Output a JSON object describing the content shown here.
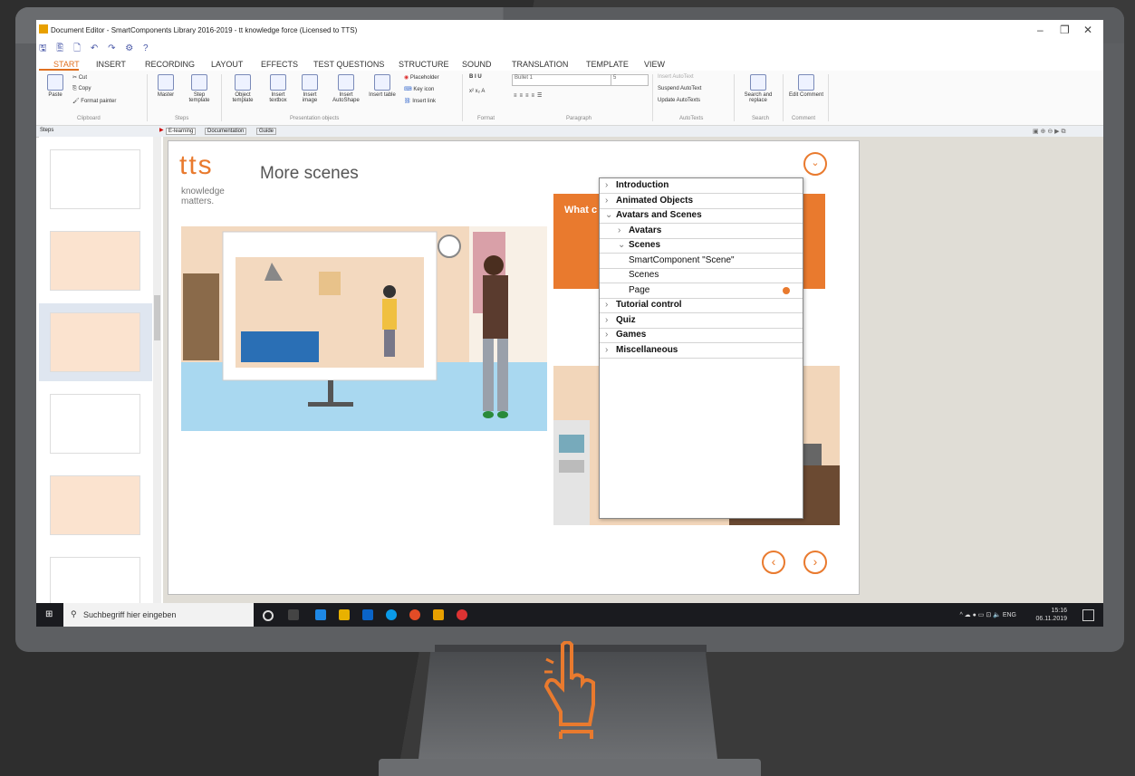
{
  "window": {
    "title": "Document Editor - SmartComponents Library 2016-2019 - tt knowledge force (Licensed to TTS)",
    "minimize": "–",
    "restore": "❐",
    "close": "✕"
  },
  "qat": "🖫 🖺 🗋 ↶ ↷ ⚙ ?",
  "tabs": [
    "START",
    "INSERT",
    "RECORDING",
    "LAYOUT",
    "EFFECTS",
    "TEST QUESTIONS",
    "STRUCTURE",
    "SOUND",
    "TRANSLATION",
    "TEMPLATE",
    "VIEW"
  ],
  "ribbon": {
    "paste": "Paste",
    "cut": "Cut",
    "copy": "Copy",
    "format_painter": "Format painter",
    "master": "Master",
    "step_template": "Step template",
    "object_template": "Object template",
    "insert_textbox": "Insert textbox",
    "insert_image": "Insert image",
    "insert_autoshape": "Insert AutoShape",
    "insert_table": "Insert table",
    "placeholder": "Placeholder",
    "key_icon": "Key icon",
    "insert_link": "Insert link",
    "bullet": "Bullet 1",
    "size": "5",
    "insert_autotext": "Insert AutoText",
    "suspend_autotext": "Suspend AutoText",
    "update_autotexts": "Update AutoTexts",
    "search_replace": "Search and replace",
    "edit_comment": "Edit Comment",
    "groups": {
      "clipboard": "Clipboard",
      "steps": "Steps",
      "presentation_objects": "Presentation objects",
      "format": "Format",
      "paragraph": "Paragraph",
      "autotexts": "AutoTexts",
      "search": "Search",
      "comment": "Comment"
    }
  },
  "panel": {
    "steps_tab": "Steps",
    "doc_tabs": [
      "E-learning",
      "Documentation",
      "Guide"
    ]
  },
  "slide": {
    "logo": "tts",
    "tagline_1": "knowledge",
    "tagline_2": "matters.",
    "title": "More scenes",
    "box_text": "What c",
    "prev": "‹",
    "next": "›"
  },
  "menu": [
    {
      "label": "Introduction",
      "bold": true,
      "indent": 0,
      "chev": ">"
    },
    {
      "label": "Animated Objects",
      "bold": true,
      "indent": 0,
      "chev": ">"
    },
    {
      "label": "Avatars and Scenes",
      "bold": true,
      "indent": 0,
      "chev": "v"
    },
    {
      "label": "Avatars",
      "bold": true,
      "indent": 1,
      "chev": ">"
    },
    {
      "label": "Scenes",
      "bold": true,
      "indent": 1,
      "chev": "v"
    },
    {
      "label": "SmartComponent \"Scene\"",
      "bold": false,
      "indent": 2,
      "chev": ""
    },
    {
      "label": "Scenes",
      "bold": false,
      "indent": 2,
      "chev": ""
    },
    {
      "label": "Page",
      "bold": false,
      "indent": 2,
      "chev": "",
      "current": true
    },
    {
      "label": "Tutorial control",
      "bold": true,
      "indent": 0,
      "chev": ">"
    },
    {
      "label": "Quiz",
      "bold": true,
      "indent": 0,
      "chev": ">"
    },
    {
      "label": "Games",
      "bold": true,
      "indent": 0,
      "chev": ">"
    },
    {
      "label": "Miscellaneous",
      "bold": true,
      "indent": 0,
      "chev": ">"
    }
  ],
  "taskbar": {
    "search": "Suchbegriff hier eingeben",
    "lang": "ENG",
    "time": "15:16",
    "date": "06.11.2019"
  },
  "colors": {
    "accent": "#e97a2e",
    "ribbon_active": "#e07020"
  }
}
